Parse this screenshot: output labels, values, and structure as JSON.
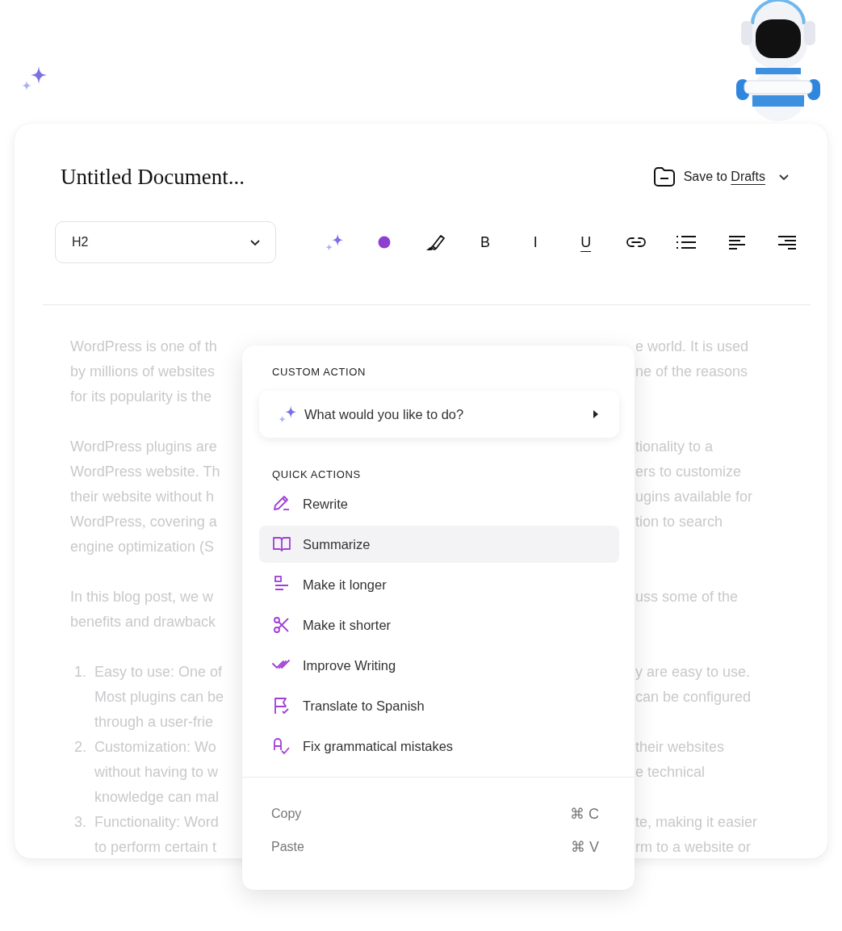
{
  "document": {
    "title": "Untitled Document...",
    "save": {
      "prefix": "Save to",
      "target": "Drafts"
    }
  },
  "toolbar": {
    "heading_select": {
      "value": "H2"
    },
    "tools": [
      {
        "kind": "sparkle"
      },
      {
        "kind": "color"
      },
      {
        "kind": "highlighter"
      },
      {
        "kind": "bold",
        "label": "B"
      },
      {
        "kind": "italic",
        "label": "I"
      },
      {
        "kind": "underline",
        "label": "U"
      },
      {
        "kind": "link"
      },
      {
        "kind": "list"
      },
      {
        "kind": "align-left"
      },
      {
        "kind": "align-right"
      }
    ]
  },
  "body": {
    "blocks": [
      {
        "lines": [
          {
            "left": "WordPress is one of th",
            "right": "e world. It is used"
          },
          {
            "left": "by millions of websites",
            "right": "ne of the reasons"
          },
          {
            "left": "for its popularity is the"
          }
        ]
      },
      {
        "lines": [
          {
            "left": "WordPress plugins are",
            "right": "tionality to a"
          },
          {
            "left": "WordPress website. Th",
            "right": "ers to customize"
          },
          {
            "left": "their website without h",
            "right": "ugins available for"
          },
          {
            "left": "WordPress, covering a",
            "right": "tion to search"
          },
          {
            "left": "engine optimization (S"
          }
        ]
      },
      {
        "lines": [
          {
            "left": "In this blog post, we w",
            "right": "uss some of the"
          },
          {
            "left": "benefits and drawback"
          }
        ]
      },
      {
        "number": "1.",
        "lines": [
          {
            "left": "Easy to use: One of",
            "right": "y are easy to use."
          },
          {
            "left": "Most plugins can be",
            "right": "can be configured"
          },
          {
            "left": "through a user-frie"
          }
        ]
      },
      {
        "number": "2.",
        "lines": [
          {
            "left": "Customization: Wo",
            "right": "their websites"
          },
          {
            "left": "without having to w",
            "right": "e technical"
          },
          {
            "left": "knowledge can mal"
          }
        ]
      },
      {
        "number": "3.",
        "lines": [
          {
            "left": "Functionality: Word",
            "right": "te, making it easier"
          },
          {
            "left": "to perform certain t",
            "right": "rm to a website or"
          }
        ]
      }
    ]
  },
  "menu": {
    "custom_heading": "CUSTOM ACTION",
    "prompt": {
      "label": "What would you like to do?"
    },
    "quick_heading": "QUICK ACTIONS",
    "actions": [
      {
        "kind": "rewrite",
        "label": "Rewrite",
        "selected": false
      },
      {
        "kind": "summarize",
        "label": "Summarize",
        "selected": true
      },
      {
        "kind": "longer",
        "label": "Make it longer",
        "selected": false
      },
      {
        "kind": "shorter",
        "label": "Make it shorter",
        "selected": false
      },
      {
        "kind": "improve",
        "label": "Improve Writing",
        "selected": false
      },
      {
        "kind": "translate",
        "label": "Translate to Spanish",
        "selected": false
      },
      {
        "kind": "grammar",
        "label": "Fix grammatical mistakes",
        "selected": false
      }
    ],
    "clipboard": [
      {
        "label": "Copy",
        "shortcut": "⌘ C"
      },
      {
        "label": "Paste",
        "shortcut": "⌘ V"
      }
    ]
  }
}
